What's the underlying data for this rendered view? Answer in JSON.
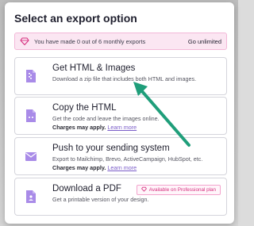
{
  "modal": {
    "title": "Select an export option",
    "banner": {
      "text": "You have made 0 out of 6 monthly exports",
      "link": "Go unlimited"
    }
  },
  "options": [
    {
      "title": "Get HTML & Images",
      "description": "Download a zip file that includes both HTML and images.",
      "icon": "zip-file-icon"
    },
    {
      "title": "Copy the HTML",
      "description": "Get the code and leave the images online.",
      "charges": "Charges may apply.",
      "learn_more": "Learn more",
      "icon": "code-file-icon"
    },
    {
      "title": "Push to your sending system",
      "description": "Export to Mailchimp, Brevo, ActiveCampaign, HubSpot, etc.",
      "charges": "Charges may apply.",
      "learn_more": "Learn more",
      "icon": "envelope-icon"
    },
    {
      "title": "Download a PDF",
      "description": "Get a printable version of your design.",
      "badge": "Available on Professional plan",
      "icon": "pdf-file-icon"
    }
  ],
  "colors": {
    "accent": "#a98be8",
    "pink": "#d6307f",
    "banner_bg": "#fbe6f2",
    "arrow": "#1f9e7a"
  }
}
